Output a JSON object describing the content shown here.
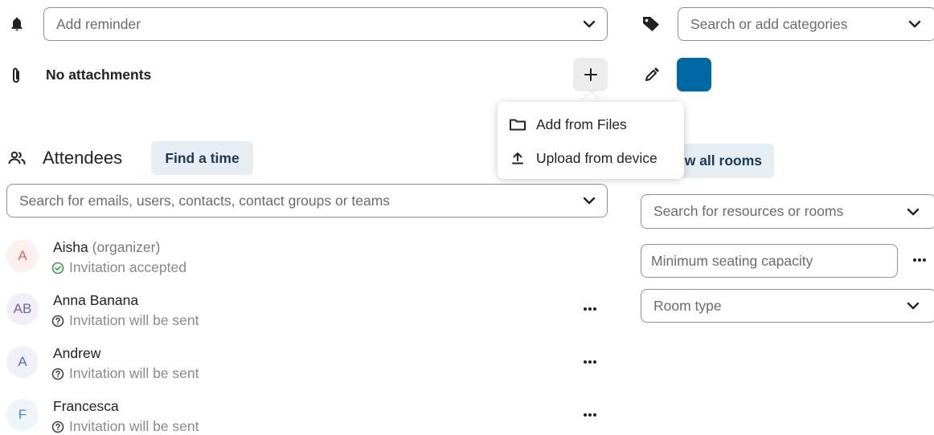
{
  "reminder": {
    "placeholder": "Add reminder"
  },
  "categories": {
    "placeholder": "Search or add categories"
  },
  "attachments": {
    "label": "No attachments"
  },
  "color": {
    "value": "#0068a5"
  },
  "attach_menu": {
    "items": [
      {
        "label": "Add from Files",
        "icon": "folder-icon"
      },
      {
        "label": "Upload from device",
        "icon": "upload-icon"
      }
    ]
  },
  "attendees": {
    "title": "Attendees",
    "find_time_label": "Find a time",
    "search_placeholder": "Search for emails, users, contacts, contact groups or teams",
    "list": [
      {
        "initials": "A",
        "name": "Aisha",
        "role": "(organizer)",
        "status": "Invitation accepted",
        "status_icon": "check-circle-icon",
        "avatar_bg": "#fbf0ee",
        "avatar_fg": "#d06a5c"
      },
      {
        "initials": "AB",
        "name": "Anna Banana",
        "status": "Invitation will be sent",
        "status_icon": "question-circle-icon",
        "avatar_bg": "#f1eef8",
        "avatar_fg": "#7a5fb0"
      },
      {
        "initials": "A",
        "name": "Andrew",
        "status": "Invitation will be sent",
        "status_icon": "question-circle-icon",
        "avatar_bg": "#eef1f9",
        "avatar_fg": "#5a6fb5"
      },
      {
        "initials": "F",
        "name": "Francesca",
        "status": "Invitation will be sent",
        "status_icon": "question-circle-icon",
        "avatar_bg": "#eef5fa",
        "avatar_fg": "#4a8bbd"
      }
    ]
  },
  "rooms": {
    "view_all_label": "w all rooms",
    "search_placeholder": "Search for resources or rooms",
    "capacity_placeholder": "Minimum seating capacity",
    "room_type_placeholder": "Room type"
  }
}
